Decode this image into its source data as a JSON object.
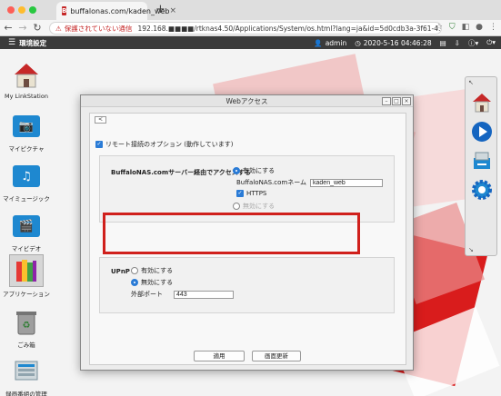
{
  "browser": {
    "tab_title": "buffalonas.com/kaden_web",
    "tab_favicon": "B",
    "tab_close": "×",
    "new_tab": "+",
    "security_warning": "保護されていない通信",
    "url_text": "192.168.■■■■/rtknas4.50/Applications/System/os.html?lang=ja&id=5d0cdb3a-3f61-4..."
  },
  "appbar": {
    "title": "環境設定",
    "user": "admin",
    "datetime": "2020-5-16 04:46:28"
  },
  "desktop_icons": [
    {
      "label": "My LinkStation"
    },
    {
      "label": "マイピクチャ"
    },
    {
      "label": "マイミュージック"
    },
    {
      "label": "マイビデオ"
    },
    {
      "label": "アプリケーション"
    },
    {
      "label": "ごみ箱"
    },
    {
      "label": "録画番組の管理"
    }
  ],
  "dialog": {
    "title": "Webアクセス",
    "back_label": "<",
    "remote_option_label": "リモート接続のオプション (動作しています)",
    "buffalonas_section_label": "BuffaloNAS.comサーバー経由でアクセスする",
    "enable_label": "有効にする",
    "buffalonas_name_label": "BuffaloNAS.comネーム",
    "buffalonas_name_value": "kaden_web",
    "https_label": "HTTPS",
    "disable_label": "無効にする",
    "upnp_label": "UPnP",
    "upnp_enable_label": "有効にする",
    "upnp_disable_label": "無効にする",
    "external_port_label": "外部ポート",
    "external_port_value": "443",
    "apply_button": "適用",
    "refresh_button": "画面更新"
  },
  "colors": {
    "accent": "#2a7bd6",
    "highlight_border": "#d0201c",
    "appbar_bg": "#3b3b3b",
    "desktop_bg": "#f3f3f3"
  }
}
